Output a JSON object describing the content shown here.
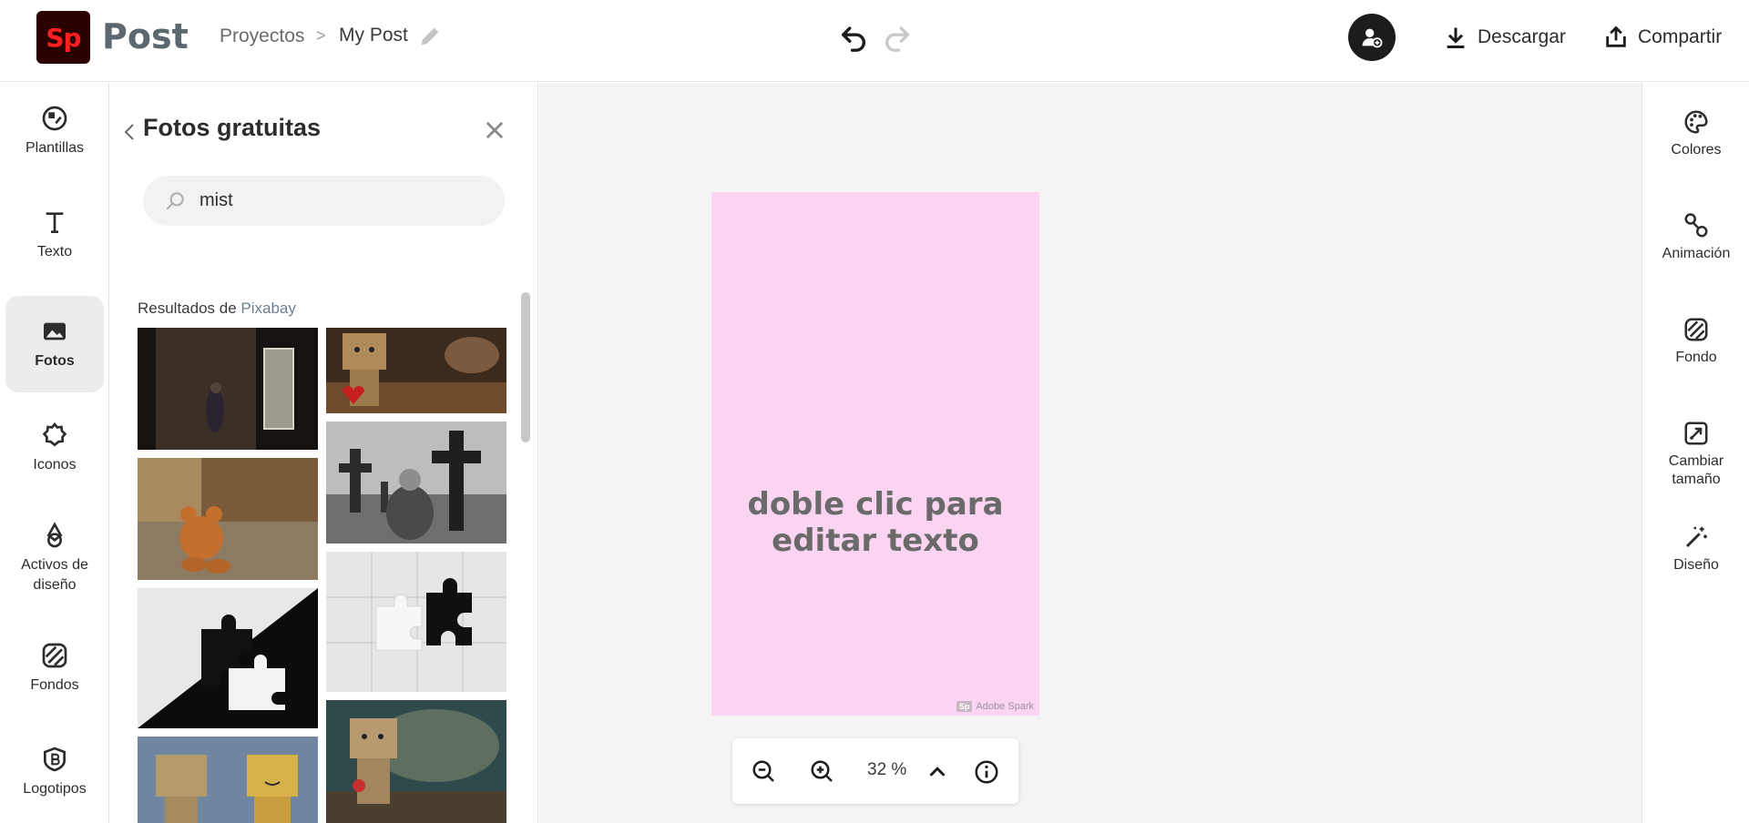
{
  "header": {
    "logo_text": "Sp",
    "app_name": "Post",
    "breadcrumb_projects": "Proyectos",
    "breadcrumb_separator": ">",
    "breadcrumb_current": "My Post",
    "download_label": "Descargar",
    "share_label": "Compartir"
  },
  "left_nav": {
    "items": [
      {
        "label": "Plantillas",
        "icon": "templates-icon"
      },
      {
        "label": "Texto",
        "icon": "text-icon"
      },
      {
        "label": "Fotos",
        "icon": "photo-icon",
        "active": true
      },
      {
        "label": "Iconos",
        "icon": "icons-icon"
      },
      {
        "label": "Activos de diseño",
        "icon": "design-assets-icon"
      },
      {
        "label": "Fondos",
        "icon": "backgrounds-icon"
      },
      {
        "label": "Logotipos",
        "icon": "logos-icon"
      }
    ]
  },
  "panel": {
    "title": "Fotos gratuitas",
    "search_value": "mist",
    "results_prefix": "Resultados de ",
    "results_source": "Pixabay"
  },
  "canvas": {
    "placeholder_text": "doble clic para editar texto",
    "watermark_badge": "Sp",
    "watermark_text": "Adobe Spark",
    "background": "#fad4f1",
    "zoom": "32 %"
  },
  "right_nav": {
    "items": [
      {
        "label": "Colores",
        "icon": "palette-icon"
      },
      {
        "label": "Animación",
        "icon": "animation-icon"
      },
      {
        "label": "Fondo",
        "icon": "background-icon"
      },
      {
        "label": "Cambiar tamaño",
        "icon": "resize-icon"
      },
      {
        "label": "Diseño",
        "icon": "magic-wand-icon"
      }
    ]
  },
  "colors": {
    "brand_logo_bg": "#2b0202",
    "brand_logo_text": "#ff1f1f",
    "workspace_bg": "#f4f4f4",
    "active_nav_bg": "#ebecee"
  }
}
